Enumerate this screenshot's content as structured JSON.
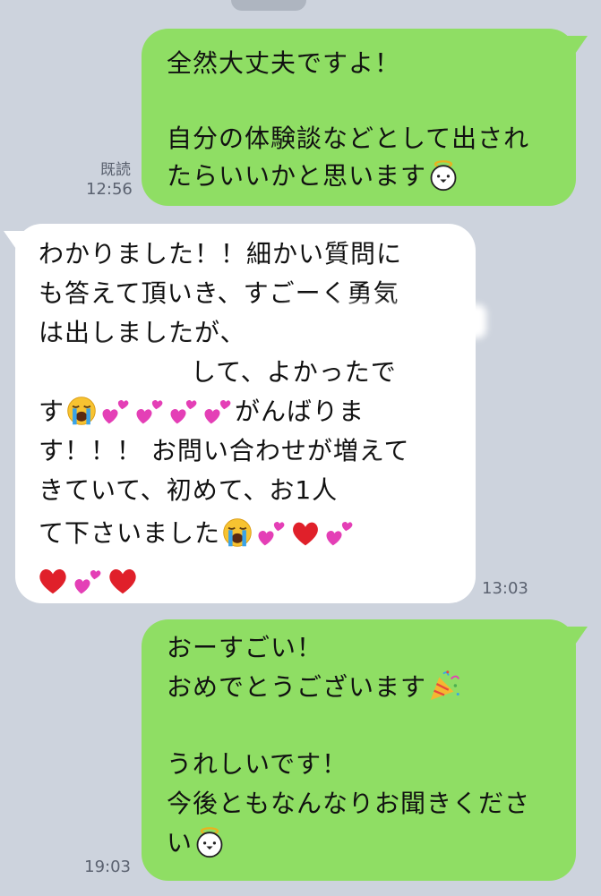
{
  "messages": [
    {
      "side": "sent",
      "read_label": "既読",
      "time": "12:56",
      "lines": [
        "全然大丈夫ですよ！",
        "",
        "自分の体験談などとして出され",
        "たらいいかと思います"
      ]
    },
    {
      "side": "received",
      "time": "13:03",
      "lines": [
        "わかりました！！細かい質問に",
        "も答えて頂いき、すごーく勇気",
        "は出しましたが、",
        "して、よかったで",
        "す",
        "がんばりま",
        "す！！！ お問い合わせが増えて",
        "きていて、初めて、お1人",
        "て下さいました"
      ]
    },
    {
      "side": "sent",
      "time": "19:03",
      "lines": [
        "おーすごい！",
        "おめでとうございます",
        "",
        "うれしいです！",
        "今後ともなんなりお聞きくださ",
        "い"
      ]
    }
  ],
  "icons": {
    "angel": "angel-face-emoji",
    "cry": "loudly-crying-face-emoji",
    "hearts": "two-hearts-emoji",
    "heart": "red-heart-emoji",
    "party": "party-popper-emoji"
  },
  "colors": {
    "background": "#cdd3dd",
    "sent_bubble": "#8fde64",
    "received_bubble": "#ffffff",
    "meta_text": "#5b6270",
    "heart": "#e0202a",
    "hearts_pink": "#e43fb6"
  }
}
